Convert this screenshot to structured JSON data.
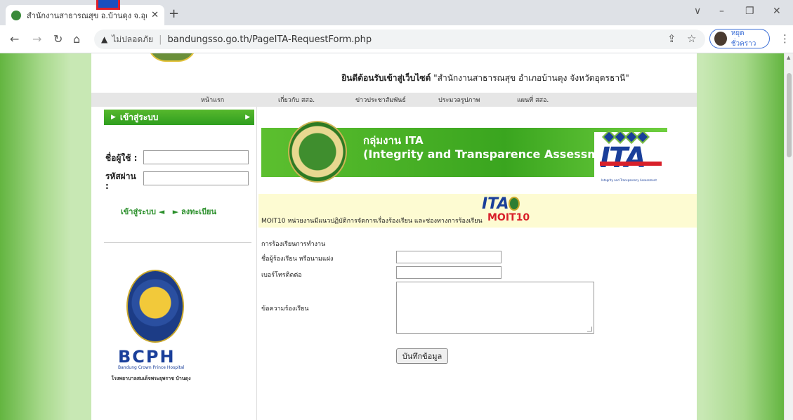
{
  "browser": {
    "tab_title": "สำนักงานสาธารณสุข อ.บ้านดุง จ.อุดร",
    "tab_close": "✕",
    "new_tab": "+",
    "insecure_label": "ไม่ปลอดภัย",
    "url": "bandungsso.go.th/PageITA-RequestForm.php",
    "profile_name": "หยุดชั่วคราว",
    "win_min": "–",
    "win_max": "❐",
    "win_close": "✕",
    "win_chevron": "∨"
  },
  "header": {
    "welcome_bold": "ยินดีต้อนรับเข้าสู่เว็บไซต์",
    "welcome_rest": "\"สำนักงานสาธารณสุข อำเภอบ้านดุง จังหวัดอุดรธานี\""
  },
  "nav": {
    "items": [
      "หน้าแรก",
      "เกี่ยวกับ สสอ.",
      "ข่าวประชาสัมพันธ์",
      "ประมวลรูปภาพ",
      "แผนที่ สสอ."
    ]
  },
  "sidebar": {
    "login_title": "เข้าสู่ระบบ",
    "username_label": "ชื่อผู้ใช้ :",
    "password_label": "รหัสผ่าน :",
    "login_link": "เข้าสู่ระบบ ◄",
    "register_link": "► ลงทะเบียน",
    "bcph": "BCPH",
    "bcph_sub": "Bandung Crown Prince Hospital",
    "hospital_name": "โรงพยาบาลสมเด็จพระยุพราช บ้านดุง"
  },
  "banner": {
    "line1": "กลุ่มงาน ITA",
    "line2": "(Integrity and Transparence Assessment)",
    "ita_logo": "ITA",
    "ita_small": "Integrity and Transparency Assessment"
  },
  "moit": {
    "description": "MOIT10 หน่วยงานมีแนวปฏิบัติการจัดการเรื่องร้องเรียน และช่องทางการร้องเรียน",
    "ita_mark": "ITA",
    "moit_label": "MOIT10"
  },
  "form": {
    "title": "การร้องเรียนการทำงาน",
    "name_label": "ชื่อผู้ร้องเรียน หรือนามแฝง",
    "phone_label": "เบอร์โทรติดต่อ",
    "message_label": "ข้อความร้องเรียน",
    "submit_label": "บันทึกข้อมูล"
  }
}
